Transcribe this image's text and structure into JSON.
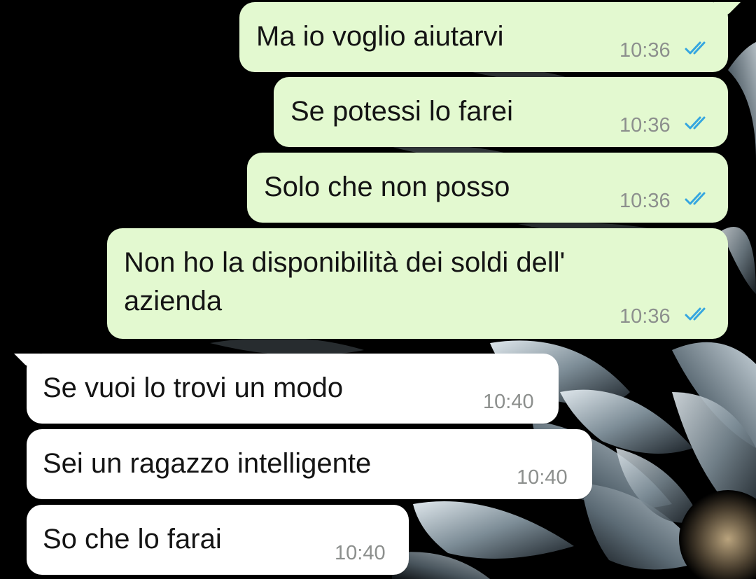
{
  "chat": {
    "messages": [
      {
        "direction": "outgoing",
        "text": "Ma io voglio aiutarvi",
        "time": "10:36",
        "status": "read"
      },
      {
        "direction": "outgoing",
        "text": "Se potessi lo farei",
        "time": "10:36",
        "status": "read"
      },
      {
        "direction": "outgoing",
        "text": "Solo che non posso",
        "time": "10:36",
        "status": "read"
      },
      {
        "direction": "outgoing",
        "text": "Non ho la disponibilità dei soldi dell'\nazienda",
        "time": "10:36",
        "status": "read"
      },
      {
        "direction": "incoming",
        "text": "Se vuoi lo trovi un modo",
        "time": "10:40"
      },
      {
        "direction": "incoming",
        "text": "Sei un ragazzo intelligente",
        "time": "10:40"
      },
      {
        "direction": "incoming",
        "text": "So che lo farai",
        "time": "10:40"
      }
    ]
  },
  "colors": {
    "outgoing_bubble": "#e3f9d0",
    "incoming_bubble": "#ffffff",
    "read_ticks": "#35a6e0",
    "timestamp": "#8c8f8d",
    "wallpaper": "#000000"
  },
  "icons": {
    "read_receipt": "double-check-icon"
  }
}
